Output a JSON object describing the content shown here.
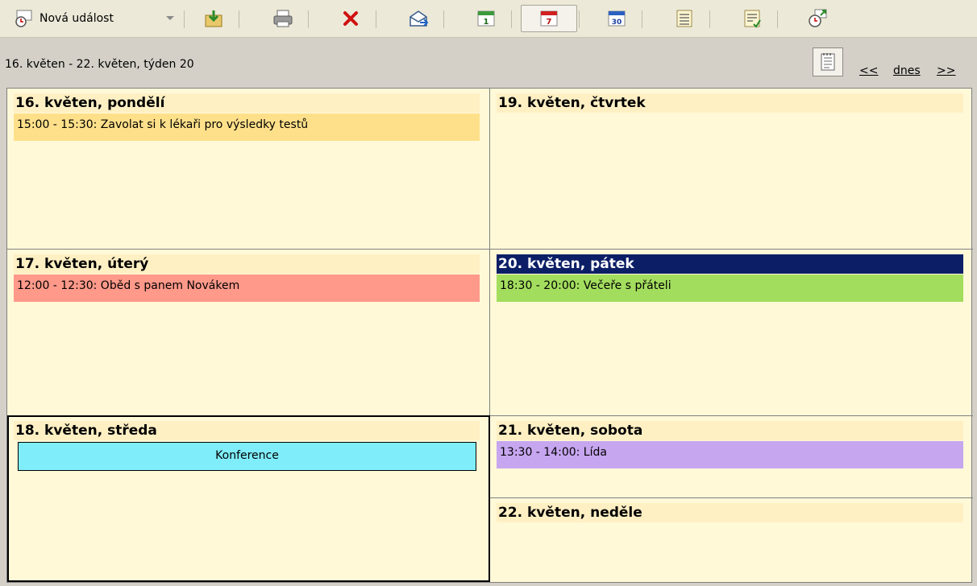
{
  "toolbar": {
    "new_event_label": "Nová událost",
    "buttons": [
      {
        "name": "import-icon"
      },
      {
        "name": "print-icon"
      },
      {
        "name": "delete-icon"
      },
      {
        "name": "send-icon"
      },
      {
        "name": "day-view-icon",
        "text": "1"
      },
      {
        "name": "week-view-icon",
        "text": "7"
      },
      {
        "name": "month-view-icon",
        "text": "30"
      },
      {
        "name": "list-view-icon"
      },
      {
        "name": "task-view-icon"
      },
      {
        "name": "reminder-icon"
      }
    ]
  },
  "header": {
    "range": "16. květen - 22. květen, týden 20",
    "prev": "<<",
    "today": "dnes",
    "next": ">>"
  },
  "days": [
    {
      "title": "16. květen, pondělí",
      "events": [
        {
          "text": "15:00 - 15:30: Zavolat si k lékaři pro výsledky testů",
          "color": "#ffe08a"
        }
      ]
    },
    {
      "title": "17. květen, úterý",
      "events": [
        {
          "text": "12:00 - 12:30: Oběd s panem Novákem",
          "color": "#ff998a"
        }
      ]
    },
    {
      "title": "18. květen, středa",
      "events": [
        {
          "text": "Konference",
          "color": "#80eefa"
        }
      ]
    },
    {
      "title": "19. květen, čtvrtek",
      "events": []
    },
    {
      "title": "20. květen, pátek",
      "events": [
        {
          "text": "18:30 - 20:00: Večeře s přáteli",
          "color": "#a3dd5e"
        }
      ]
    },
    {
      "title": "21. květen, sobota",
      "events": [
        {
          "text": "13:30 - 14:00: Lída",
          "color": "#c7a6f0"
        }
      ]
    },
    {
      "title": "22. květen, neděle",
      "events": []
    }
  ],
  "colors": {
    "grid_bg": "#fff9d8",
    "day_head_bg": "#fff0c4",
    "today_head_bg": "#0c1f66"
  }
}
